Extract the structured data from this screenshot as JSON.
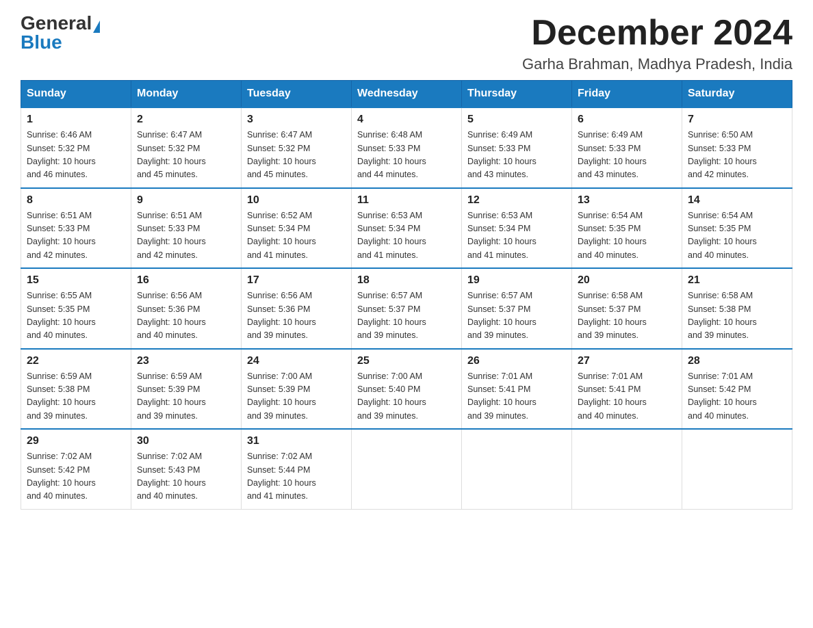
{
  "header": {
    "logo_general": "General",
    "logo_blue": "Blue",
    "month_year": "December 2024",
    "location": "Garha Brahman, Madhya Pradesh, India"
  },
  "days_of_week": [
    "Sunday",
    "Monday",
    "Tuesday",
    "Wednesday",
    "Thursday",
    "Friday",
    "Saturday"
  ],
  "weeks": [
    [
      {
        "day": "1",
        "sunrise": "6:46 AM",
        "sunset": "5:32 PM",
        "daylight": "10 hours and 46 minutes."
      },
      {
        "day": "2",
        "sunrise": "6:47 AM",
        "sunset": "5:32 PM",
        "daylight": "10 hours and 45 minutes."
      },
      {
        "day": "3",
        "sunrise": "6:47 AM",
        "sunset": "5:32 PM",
        "daylight": "10 hours and 45 minutes."
      },
      {
        "day": "4",
        "sunrise": "6:48 AM",
        "sunset": "5:33 PM",
        "daylight": "10 hours and 44 minutes."
      },
      {
        "day": "5",
        "sunrise": "6:49 AM",
        "sunset": "5:33 PM",
        "daylight": "10 hours and 43 minutes."
      },
      {
        "day": "6",
        "sunrise": "6:49 AM",
        "sunset": "5:33 PM",
        "daylight": "10 hours and 43 minutes."
      },
      {
        "day": "7",
        "sunrise": "6:50 AM",
        "sunset": "5:33 PM",
        "daylight": "10 hours and 42 minutes."
      }
    ],
    [
      {
        "day": "8",
        "sunrise": "6:51 AM",
        "sunset": "5:33 PM",
        "daylight": "10 hours and 42 minutes."
      },
      {
        "day": "9",
        "sunrise": "6:51 AM",
        "sunset": "5:33 PM",
        "daylight": "10 hours and 42 minutes."
      },
      {
        "day": "10",
        "sunrise": "6:52 AM",
        "sunset": "5:34 PM",
        "daylight": "10 hours and 41 minutes."
      },
      {
        "day": "11",
        "sunrise": "6:53 AM",
        "sunset": "5:34 PM",
        "daylight": "10 hours and 41 minutes."
      },
      {
        "day": "12",
        "sunrise": "6:53 AM",
        "sunset": "5:34 PM",
        "daylight": "10 hours and 41 minutes."
      },
      {
        "day": "13",
        "sunrise": "6:54 AM",
        "sunset": "5:35 PM",
        "daylight": "10 hours and 40 minutes."
      },
      {
        "day": "14",
        "sunrise": "6:54 AM",
        "sunset": "5:35 PM",
        "daylight": "10 hours and 40 minutes."
      }
    ],
    [
      {
        "day": "15",
        "sunrise": "6:55 AM",
        "sunset": "5:35 PM",
        "daylight": "10 hours and 40 minutes."
      },
      {
        "day": "16",
        "sunrise": "6:56 AM",
        "sunset": "5:36 PM",
        "daylight": "10 hours and 40 minutes."
      },
      {
        "day": "17",
        "sunrise": "6:56 AM",
        "sunset": "5:36 PM",
        "daylight": "10 hours and 39 minutes."
      },
      {
        "day": "18",
        "sunrise": "6:57 AM",
        "sunset": "5:37 PM",
        "daylight": "10 hours and 39 minutes."
      },
      {
        "day": "19",
        "sunrise": "6:57 AM",
        "sunset": "5:37 PM",
        "daylight": "10 hours and 39 minutes."
      },
      {
        "day": "20",
        "sunrise": "6:58 AM",
        "sunset": "5:37 PM",
        "daylight": "10 hours and 39 minutes."
      },
      {
        "day": "21",
        "sunrise": "6:58 AM",
        "sunset": "5:38 PM",
        "daylight": "10 hours and 39 minutes."
      }
    ],
    [
      {
        "day": "22",
        "sunrise": "6:59 AM",
        "sunset": "5:38 PM",
        "daylight": "10 hours and 39 minutes."
      },
      {
        "day": "23",
        "sunrise": "6:59 AM",
        "sunset": "5:39 PM",
        "daylight": "10 hours and 39 minutes."
      },
      {
        "day": "24",
        "sunrise": "7:00 AM",
        "sunset": "5:39 PM",
        "daylight": "10 hours and 39 minutes."
      },
      {
        "day": "25",
        "sunrise": "7:00 AM",
        "sunset": "5:40 PM",
        "daylight": "10 hours and 39 minutes."
      },
      {
        "day": "26",
        "sunrise": "7:01 AM",
        "sunset": "5:41 PM",
        "daylight": "10 hours and 39 minutes."
      },
      {
        "day": "27",
        "sunrise": "7:01 AM",
        "sunset": "5:41 PM",
        "daylight": "10 hours and 40 minutes."
      },
      {
        "day": "28",
        "sunrise": "7:01 AM",
        "sunset": "5:42 PM",
        "daylight": "10 hours and 40 minutes."
      }
    ],
    [
      {
        "day": "29",
        "sunrise": "7:02 AM",
        "sunset": "5:42 PM",
        "daylight": "10 hours and 40 minutes."
      },
      {
        "day": "30",
        "sunrise": "7:02 AM",
        "sunset": "5:43 PM",
        "daylight": "10 hours and 40 minutes."
      },
      {
        "day": "31",
        "sunrise": "7:02 AM",
        "sunset": "5:44 PM",
        "daylight": "10 hours and 41 minutes."
      },
      null,
      null,
      null,
      null
    ]
  ],
  "labels": {
    "sunrise": "Sunrise:",
    "sunset": "Sunset:",
    "daylight": "Daylight:"
  }
}
